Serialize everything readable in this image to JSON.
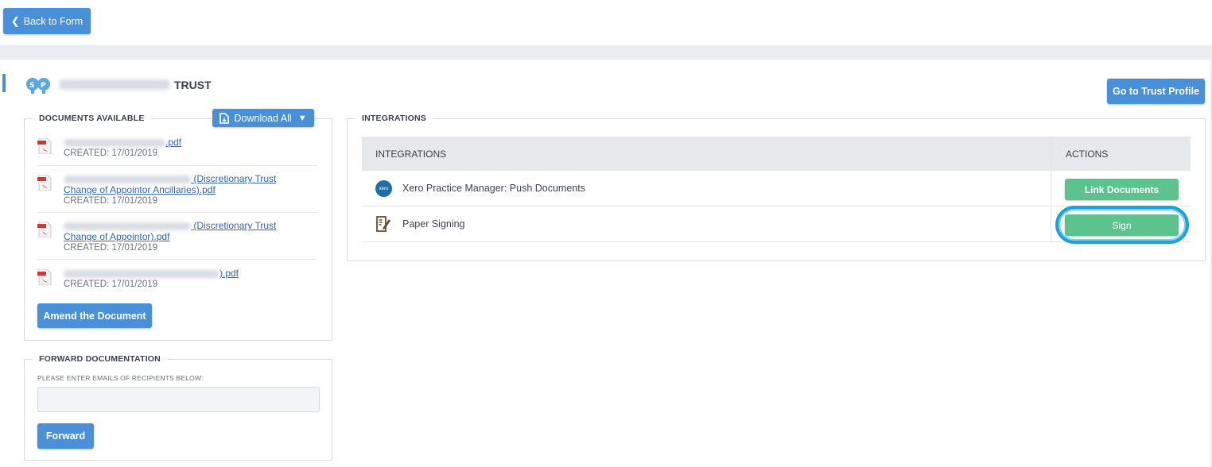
{
  "toolbar": {
    "back_label": "Back to Form"
  },
  "entity": {
    "name_suffix": "TRUST",
    "profile_button": "Go to Trust Profile"
  },
  "documents": {
    "legend": "DOCUMENTS AVAILABLE",
    "download_all": "Download All",
    "items": [
      {
        "line1": ".pdf",
        "line2": "",
        "created": "CREATED: 17/01/2019"
      },
      {
        "line1": "(Discretionary Trust",
        "line2": "Change of Appointor Ancillaries).pdf",
        "created": "CREATED: 17/01/2019"
      },
      {
        "line1": "(Discretionary Trust",
        "line2": "Change of Appointor).pdf",
        "created": "CREATED: 17/01/2019"
      },
      {
        "line1": ").pdf",
        "line2": "",
        "created": "CREATED: 17/01/2019"
      }
    ],
    "amend_button": "Amend the Document"
  },
  "forward": {
    "legend": "FORWARD DOCUMENTATION",
    "label": "PLEASE ENTER EMAILS OF RECIPIENTS BELOW:",
    "input_value": "",
    "button": "Forward"
  },
  "integrations": {
    "legend": "INTEGRATIONS",
    "col_integrations": "INTEGRATIONS",
    "col_actions": "ACTIONS",
    "rows": [
      {
        "icon": "xero-icon",
        "icon_text": "xero",
        "label": "Xero Practice Manager: Push Documents",
        "action": "Link Documents"
      },
      {
        "icon": "paper-signing-icon",
        "label": "Paper Signing",
        "action": "Sign"
      }
    ]
  },
  "colors": {
    "primary": "#4a90d9",
    "success": "#5cc28e",
    "highlight": "#1fa0de",
    "link": "#3565b5"
  }
}
